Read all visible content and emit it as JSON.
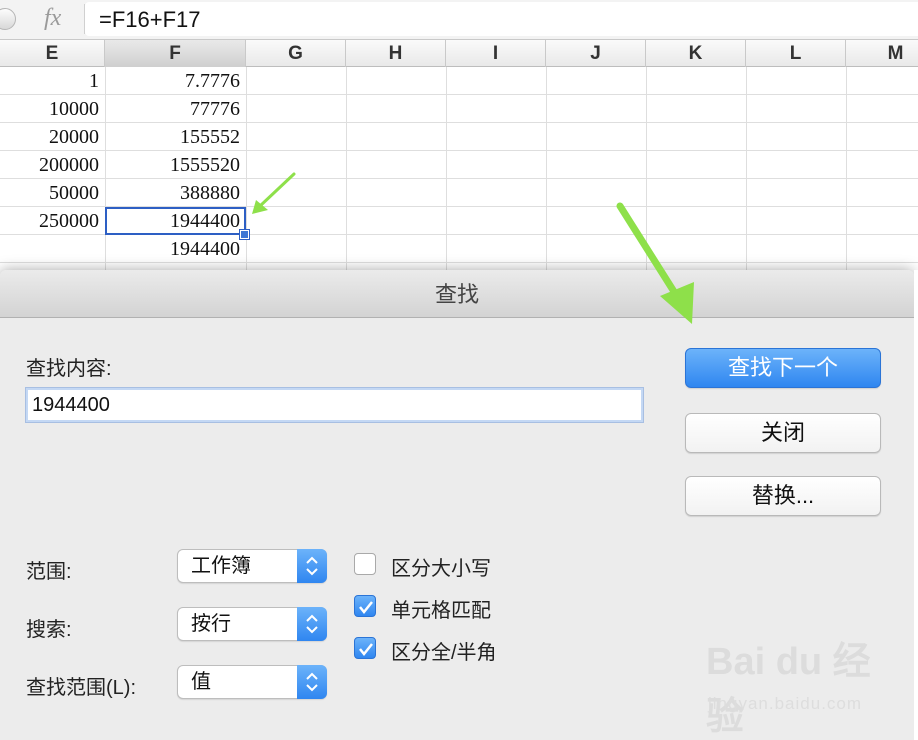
{
  "formula_bar": {
    "fx_label": "fx",
    "formula": "=F16+F17"
  },
  "columns": [
    "E",
    "F",
    "G",
    "H",
    "I",
    "J",
    "K",
    "L",
    "M"
  ],
  "selected_column": "F",
  "rows": [
    {
      "E": "1",
      "F": "7.7776"
    },
    {
      "E": "10000",
      "F": "77776"
    },
    {
      "E": "20000",
      "F": "155552"
    },
    {
      "E": "200000",
      "F": "1555520"
    },
    {
      "E": "50000",
      "F": "388880"
    },
    {
      "E": "250000",
      "F": "1944400"
    },
    {
      "E": "",
      "F": "1944400"
    }
  ],
  "dialog": {
    "title": "查找",
    "find_label": "查找内容:",
    "find_value": "1944400",
    "buttons": {
      "find_next": "查找下一个",
      "close": "关闭",
      "replace": "替换..."
    },
    "options": {
      "scope_label": "范围:",
      "scope_value": "工作簿",
      "search_label": "搜索:",
      "search_value": "按行",
      "lookin_label": "查找范围(L):",
      "lookin_value": "值"
    },
    "checkboxes": {
      "match_case": {
        "label": "区分大小写",
        "checked": false
      },
      "match_cell": {
        "label": "单元格匹配",
        "checked": true
      },
      "match_width": {
        "label": "区分全/半角",
        "checked": true
      }
    }
  },
  "watermark": {
    "logo": "Bai du 经验",
    "url": "jingyan.baidu.com"
  },
  "colors": {
    "accent_blue": "#2f86f0",
    "arrow_green": "#8ee04a",
    "selection_border": "#2d5fc4"
  }
}
